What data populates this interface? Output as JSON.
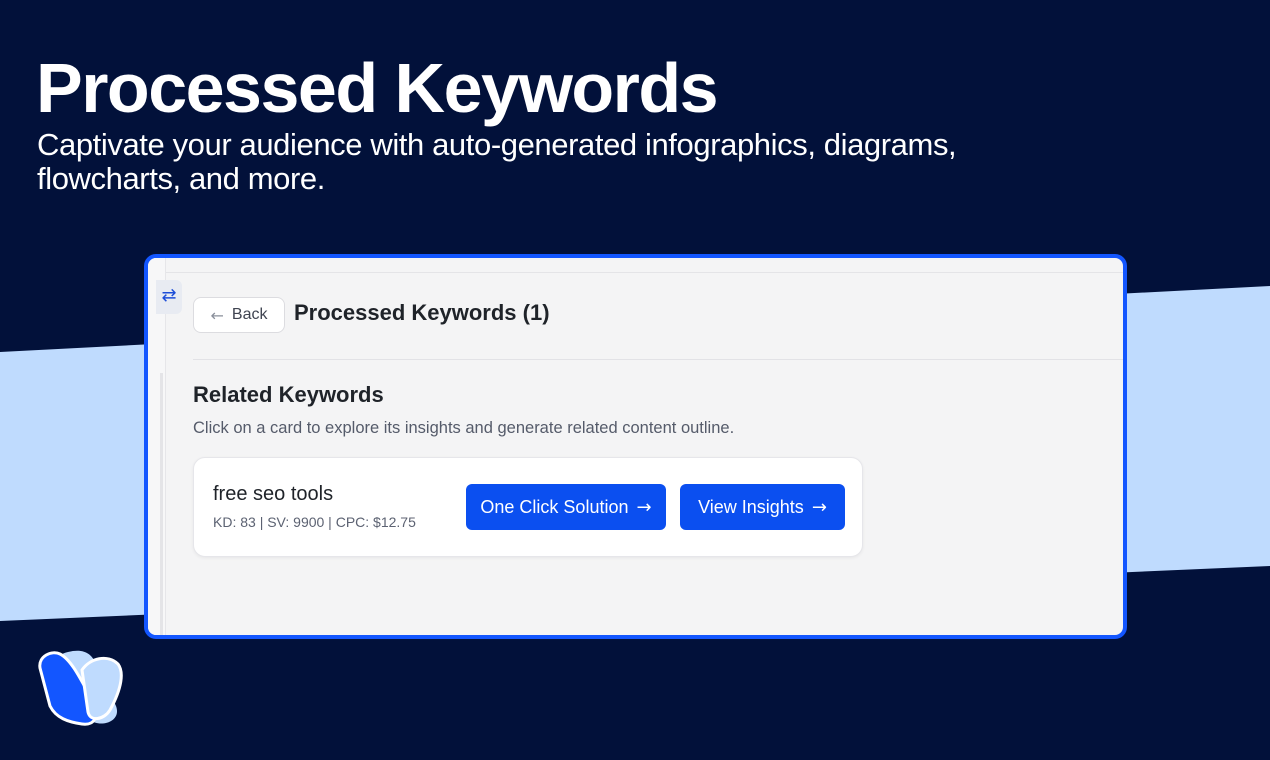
{
  "hero": {
    "title": "Processed Keywords",
    "subtitle": "Captivate your audience with auto-generated infographics, diagrams, flowcharts, and more."
  },
  "app": {
    "back_label": "Back",
    "page_title": "Processed Keywords (1)",
    "section_title": "Related Keywords",
    "section_description": "Click on a card to explore its insights and generate related content outline.",
    "cards": [
      {
        "keyword": "free seo tools",
        "metrics": "KD: 83 | SV: 9900 | CPC: $12.75",
        "primary_action": "One Click Solution",
        "secondary_action": "View Insights"
      }
    ]
  },
  "colors": {
    "background": "#02113a",
    "band": "#bfdbfe",
    "accent": "#0b4ff0",
    "window_border": "#1356ff"
  },
  "icons": {
    "sidebar_toggle": "swap-arrows-icon",
    "back": "arrow-left-icon",
    "action": "arrow-right-icon",
    "brand": "brand-logo-icon"
  }
}
